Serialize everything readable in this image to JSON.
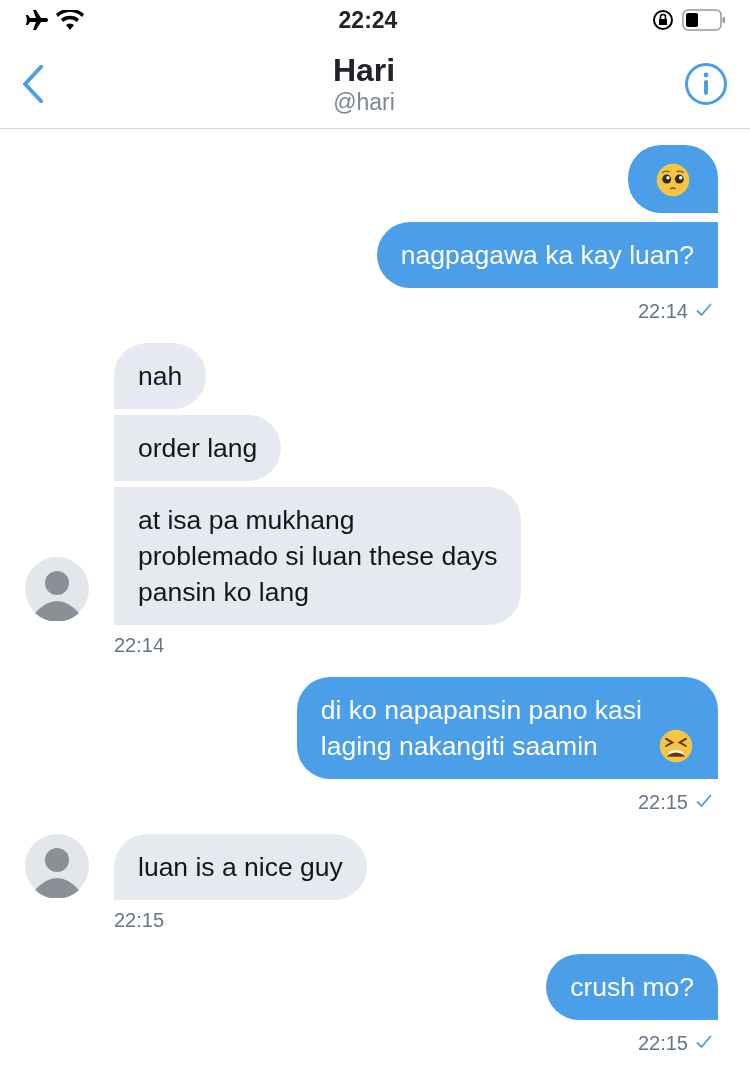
{
  "status_bar": {
    "time": "22:24"
  },
  "header": {
    "name": "Hari",
    "handle": "@hari"
  },
  "groups": [
    {
      "kind": "sent",
      "time": "22:14",
      "delivered": true,
      "messages": [
        {
          "kind": "pleading"
        },
        {
          "kind": "text",
          "text": "nagpagawa ka kay luan?"
        }
      ]
    },
    {
      "kind": "received",
      "time": "22:14",
      "messages": [
        {
          "kind": "text",
          "text": "nah"
        },
        {
          "kind": "text",
          "text": "order lang"
        },
        {
          "kind": "text",
          "text": "at isa pa mukhang\nproblemado si luan these days\npansin ko lang"
        }
      ]
    },
    {
      "kind": "sent",
      "time": "22:15",
      "delivered": true,
      "messages": [
        {
          "kind": "text-tired",
          "text": "di ko napapansin pano kasi\nlaging nakangiti saamin"
        }
      ]
    },
    {
      "kind": "received",
      "time": "22:15",
      "messages": [
        {
          "kind": "text",
          "text": "luan is a nice guy"
        }
      ]
    },
    {
      "kind": "sent",
      "time": "22:15",
      "delivered": true,
      "messages": [
        {
          "kind": "text",
          "text": "crush mo?"
        }
      ]
    }
  ]
}
